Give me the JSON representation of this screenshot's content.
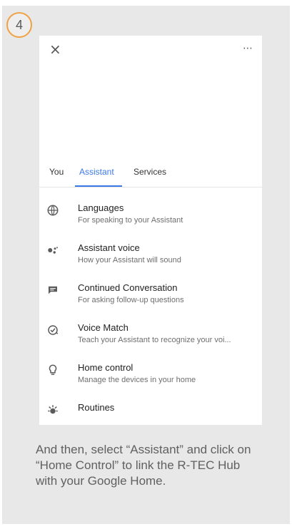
{
  "step": {
    "number": "4"
  },
  "topbar": {
    "close_icon": "×",
    "more_icon": "⋯"
  },
  "tabs": [
    {
      "label": "You"
    },
    {
      "label": "Assistant",
      "active": true
    },
    {
      "label": "Services"
    }
  ],
  "list": [
    {
      "icon": "globe-icon",
      "title": "Languages",
      "subtitle": "For speaking to your Assistant"
    },
    {
      "icon": "assistant-dots-icon",
      "title": "Assistant voice",
      "subtitle": "How your Assistant will sound"
    },
    {
      "icon": "chat-icon",
      "title": "Continued Conversation",
      "subtitle": "For asking follow-up questions"
    },
    {
      "icon": "voice-match-icon",
      "title": "Voice Match",
      "subtitle": "Teach your Assistant to recognize your voi..."
    },
    {
      "icon": "lightbulb-icon",
      "title": "Home control",
      "subtitle": "Manage the devices in your home"
    },
    {
      "icon": "routines-icon",
      "title": "Routines",
      "subtitle": ""
    }
  ],
  "caption": {
    "text": "And then, select “Assistant” and click on “Home Control” to link the R-TEC Hub with your Google Home."
  },
  "colors": {
    "accent": "#3b78e7",
    "badge_border": "#f0a243",
    "panel_bg": "#e8e8e8"
  }
}
